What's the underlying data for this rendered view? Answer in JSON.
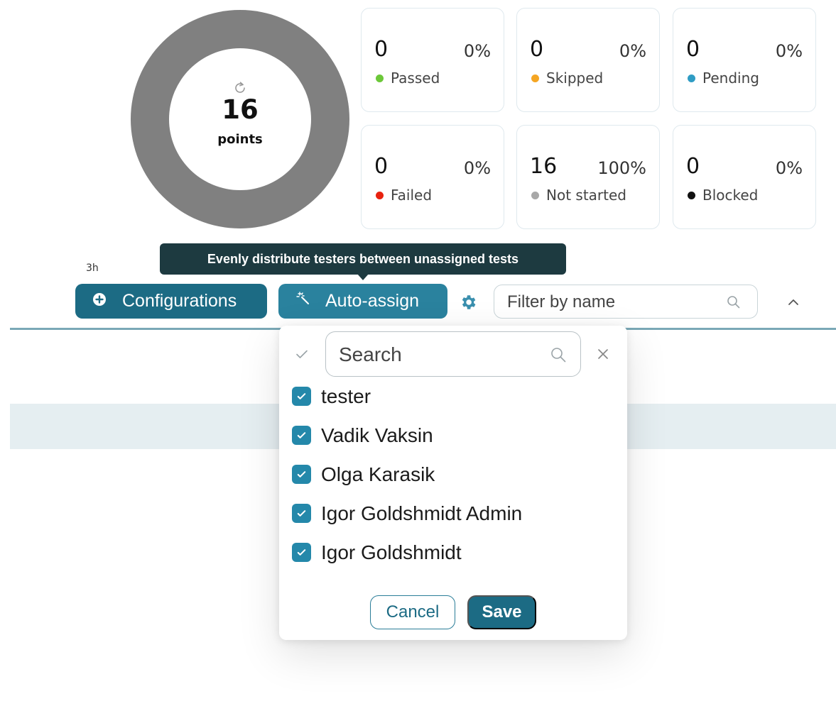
{
  "summary": {
    "total_count": "16",
    "total_unit": "points",
    "donut_color": "#808080"
  },
  "stats": [
    {
      "count": "0",
      "percent": "0%",
      "label": "Passed",
      "color": "#6cc839"
    },
    {
      "count": "0",
      "percent": "0%",
      "label": "Skipped",
      "color": "#f5a623"
    },
    {
      "count": "0",
      "percent": "0%",
      "label": "Pending",
      "color": "#2f9cc4"
    },
    {
      "count": "0",
      "percent": "0%",
      "label": "Failed",
      "color": "#e8220f"
    },
    {
      "count": "16",
      "percent": "100%",
      "label": "Not started",
      "color": "#a8a8a8"
    },
    {
      "count": "0",
      "percent": "0%",
      "label": "Blocked",
      "color": "#111111"
    }
  ],
  "duration": "3h",
  "tooltip": "Evenly distribute testers between unassigned tests",
  "toolbar": {
    "configurations_label": "Configurations",
    "auto_assign_label": "Auto-assign",
    "filter_placeholder": "Filter by name"
  },
  "dropdown": {
    "search_placeholder": "Search",
    "testers": [
      {
        "name": "tester",
        "checked": true
      },
      {
        "name": "Vadik Vaksin",
        "checked": true
      },
      {
        "name": "Olga Karasik",
        "checked": true
      },
      {
        "name": "Igor Goldshmidt Admin",
        "checked": true
      },
      {
        "name": "Igor Goldshmidt",
        "checked": true
      }
    ],
    "cancel_label": "Cancel",
    "save_label": "Save"
  },
  "colors": {
    "primary": "#1c6b84",
    "primary_light": "#2a829e",
    "checkbox": "#2488aa",
    "tooltip_bg": "#1d3a40"
  }
}
